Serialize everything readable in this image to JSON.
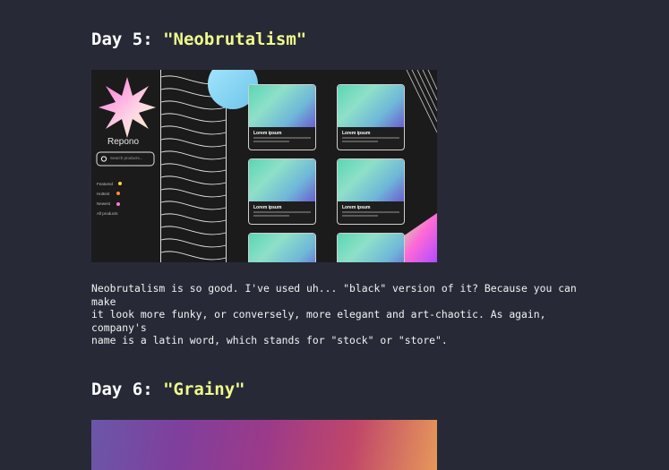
{
  "day5": {
    "label": "Day 5:",
    "title": "\"Neobrutalism\"",
    "screenshot": {
      "brand": "Repono",
      "search_placeholder": "Search products...",
      "nav": [
        "Featured",
        "Hottest",
        "Newest",
        "All products"
      ],
      "card_title": "Lorem ipsum"
    },
    "description": "Neobrutalism is so good. I've used uh... \"black\" version of it? Because you can make\nit look more funky, or conversely, more elegant and art-chaotic. As again, company's\nname is a latin word, which stands for \"stock\" or \"store\"."
  },
  "day6": {
    "label": "Day 6:",
    "title": "\"Grainy\""
  },
  "colors": {
    "background": "#272a36",
    "accent": "#f1fa8c"
  }
}
